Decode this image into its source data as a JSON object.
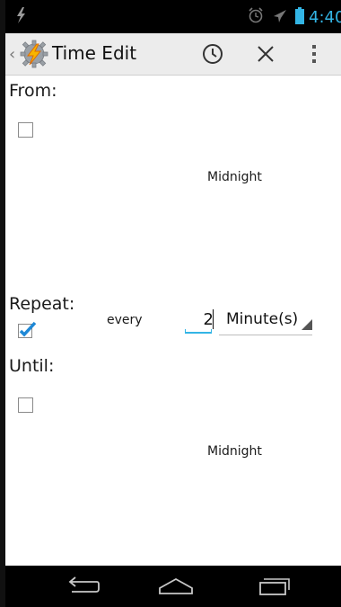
{
  "status_bar": {
    "time": "4:40",
    "icons": [
      "bolt-icon",
      "alarm-icon",
      "airplane-icon",
      "battery-icon"
    ],
    "accent_color": "#33b5e5"
  },
  "action_bar": {
    "title": "Time Edit",
    "icons": [
      "up-caret-icon",
      "app-icon",
      "clock-icon",
      "close-icon",
      "overflow-menu-icon"
    ]
  },
  "form": {
    "from": {
      "label": "From:",
      "checked": false,
      "time": "Midnight"
    },
    "repeat": {
      "label": "Repeat:",
      "checked": true,
      "every_label": "every",
      "interval_value": "2",
      "unit": "Minute(s)"
    },
    "until": {
      "label": "Until:",
      "checked": false,
      "time": "Midnight"
    }
  },
  "nav_bar": {
    "icons": [
      "back-icon",
      "home-icon",
      "recents-icon"
    ]
  }
}
